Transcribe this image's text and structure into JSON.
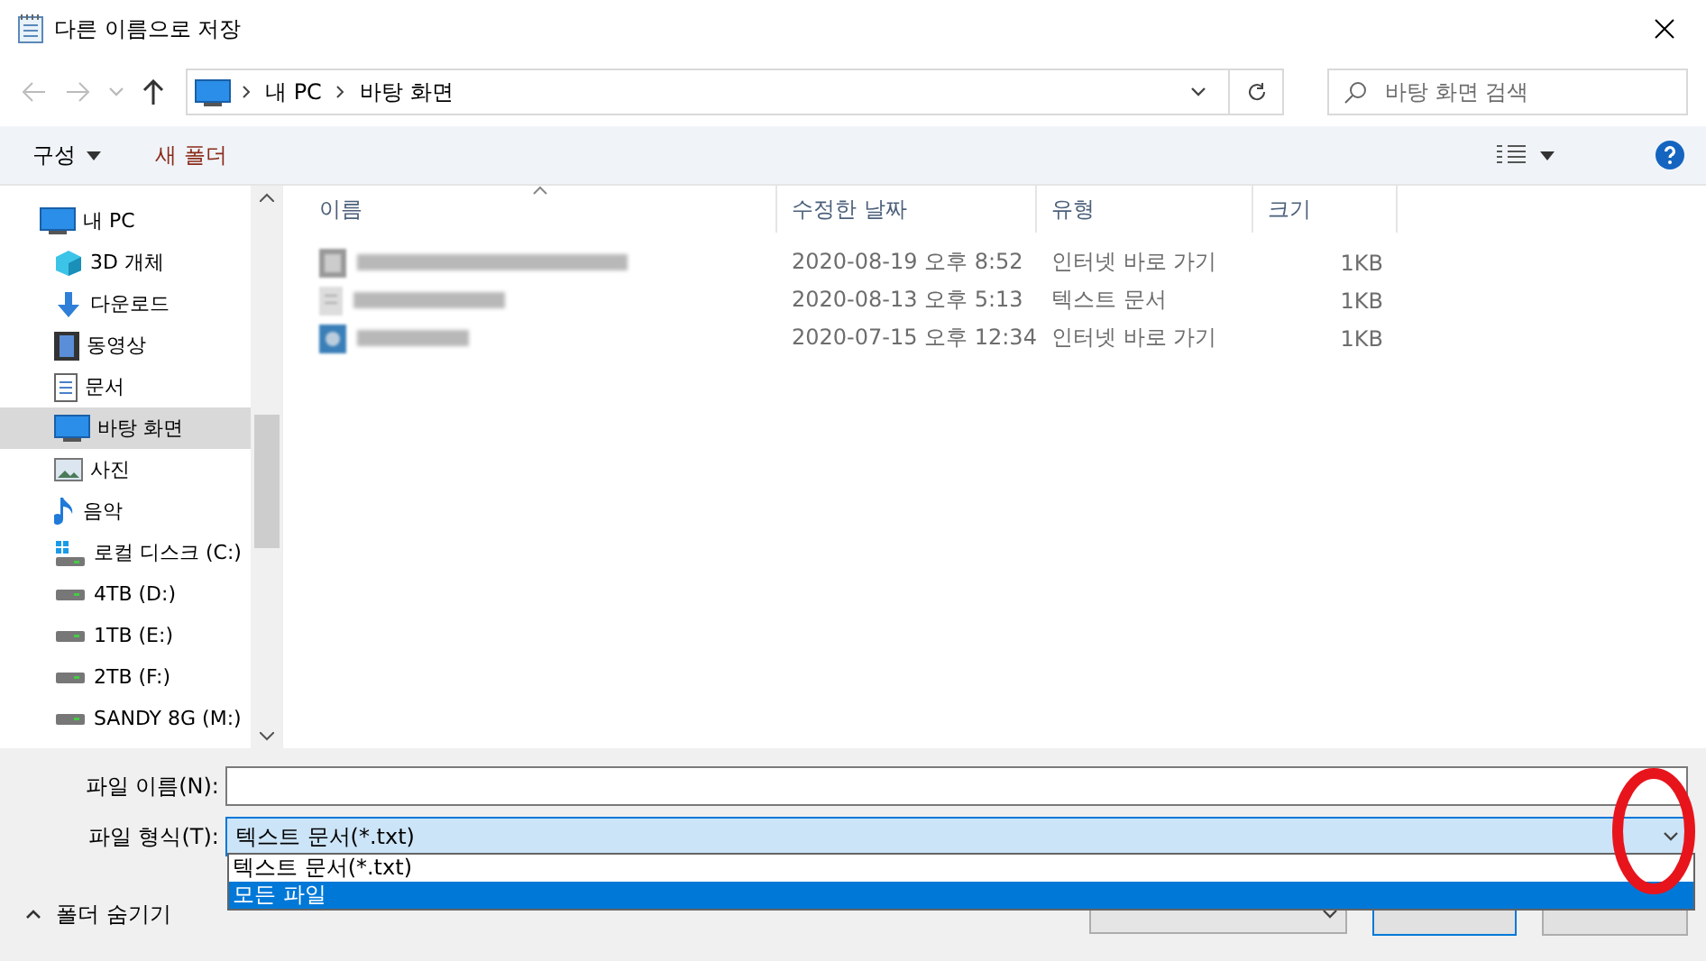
{
  "window": {
    "title": "다른 이름으로 저장"
  },
  "address": {
    "segments": [
      "내 PC",
      "바탕 화면"
    ]
  },
  "search": {
    "placeholder": "바탕 화면 검색"
  },
  "toolbar": {
    "organize": "구성",
    "new_folder": "새 폴더"
  },
  "sidebar": {
    "items": [
      {
        "label": "내 PC",
        "kind": "pc",
        "selected": false,
        "children": [
          {
            "label": "3D 개체",
            "kind": "cube",
            "selected": false
          },
          {
            "label": "다운로드",
            "kind": "download",
            "selected": false
          },
          {
            "label": "동영상",
            "kind": "video",
            "selected": false
          },
          {
            "label": "문서",
            "kind": "document",
            "selected": false
          },
          {
            "label": "바탕 화면",
            "kind": "desktop",
            "selected": true
          },
          {
            "label": "사진",
            "kind": "photo",
            "selected": false
          },
          {
            "label": "음악",
            "kind": "music",
            "selected": false
          },
          {
            "label": "로컬 디스크 (C:)",
            "kind": "system-drive",
            "selected": false
          },
          {
            "label": "4TB (D:)",
            "kind": "drive",
            "selected": false
          },
          {
            "label": "1TB (E:)",
            "kind": "drive",
            "selected": false
          },
          {
            "label": "2TB (F:)",
            "kind": "drive",
            "selected": false
          },
          {
            "label": "SANDY 8G (M:)",
            "kind": "drive",
            "selected": false
          }
        ]
      }
    ]
  },
  "table": {
    "columns": [
      "이름",
      "수정한 날짜",
      "유형",
      "크기"
    ],
    "rows": [
      {
        "kind": "grid",
        "modified": "2020-08-19 오후 8:52",
        "type": "인터넷 바로 가기",
        "size": "1KB"
      },
      {
        "kind": "text",
        "modified": "2020-08-13 오후 5:13",
        "type": "텍스트 문서",
        "size": "1KB"
      },
      {
        "kind": "plane",
        "modified": "2020-07-15 오후 12:34",
        "type": "인터넷 바로 가기",
        "size": "1KB"
      }
    ]
  },
  "form": {
    "file_name_label": "파일 이름(N):",
    "file_type_label": "파일 형식(T):",
    "file_type_value": "텍스트 문서(*.txt)",
    "file_type_options": [
      {
        "label": "텍스트 문서(*.txt)",
        "selected": false
      },
      {
        "label": "모든 파일",
        "selected": true
      }
    ]
  },
  "footer": {
    "hide_folders": "폴더 숨기기"
  }
}
